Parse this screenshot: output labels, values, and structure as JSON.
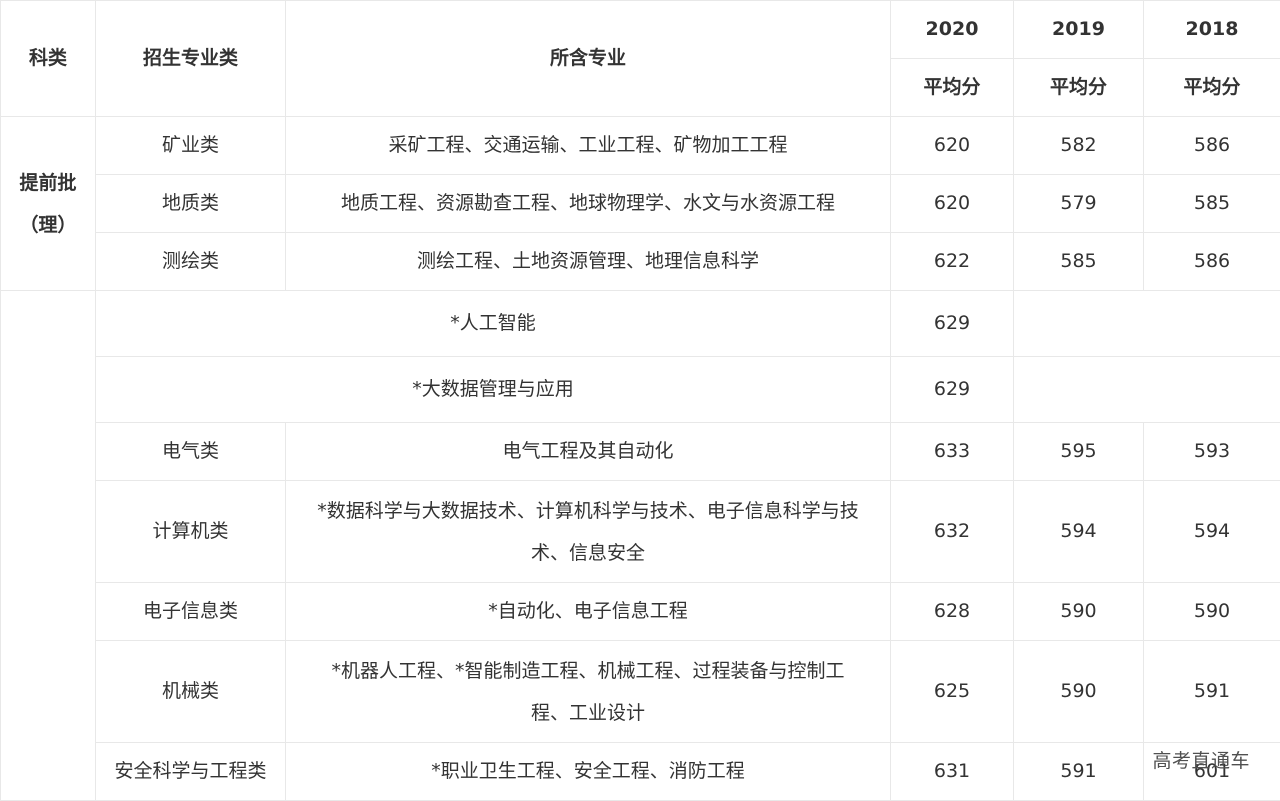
{
  "header": {
    "category": "科类",
    "major_class": "招生专业类",
    "majors": "所含专业",
    "years": [
      "2020",
      "2019",
      "2018"
    ],
    "avg_label": "平均分"
  },
  "early_batch": {
    "label_line1": "提前批",
    "label_line2": "（理）",
    "rows": [
      {
        "major_class": "矿业类",
        "majors": "采矿工程、交通运输、工业工程、矿物加工工程",
        "s2020": "620",
        "s2019": "582",
        "s2018": "586"
      },
      {
        "major_class": "地质类",
        "majors": "地质工程、资源勘查工程、地球物理学、水文与水资源工程",
        "s2020": "620",
        "s2019": "579",
        "s2018": "585"
      },
      {
        "major_class": "测绘类",
        "majors": "测绘工程、土地资源管理、地理信息科学",
        "s2020": "622",
        "s2019": "585",
        "s2018": "586"
      }
    ]
  },
  "special_rows": [
    {
      "name": "*人工智能",
      "s2020": "629"
    },
    {
      "name": "*大数据管理与应用",
      "s2020": "629"
    }
  ],
  "rows": [
    {
      "major_class": "电气类",
      "majors": "电气工程及其自动化",
      "s2020": "633",
      "s2019": "595",
      "s2018": "593"
    },
    {
      "major_class": "计算机类",
      "majors_l1": "*数据科学与大数据技术、计算机科学与技术、电子信息科学与技",
      "majors_l2": "术、信息安全",
      "s2020": "632",
      "s2019": "594",
      "s2018": "594"
    },
    {
      "major_class": "电子信息类",
      "majors": "*自动化、电子信息工程",
      "s2020": "628",
      "s2019": "590",
      "s2018": "590"
    },
    {
      "major_class": "机械类",
      "majors_l1": "*机器人工程、*智能制造工程、机械工程、过程装备与控制工",
      "majors_l2": "程、工业设计",
      "s2020": "625",
      "s2019": "590",
      "s2018": "591"
    },
    {
      "major_class": "安全科学与工程类",
      "majors": "*职业卫生工程、安全工程、消防工程",
      "s2020": "631",
      "s2019": "591",
      "s2018": "601"
    }
  ],
  "watermark": "高考直通车"
}
